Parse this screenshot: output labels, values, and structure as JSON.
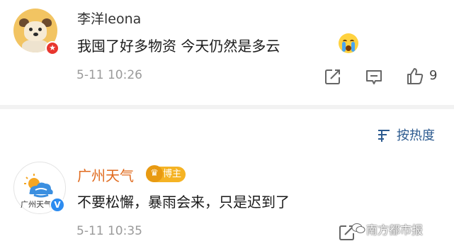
{
  "comments": [
    {
      "username": "李洋leona",
      "avatar": "dog-avatar",
      "avatar_badge": "★",
      "text": "我囤了好多物资 今天仍然是多云",
      "emoji": "crying-face-emoji",
      "time": "5-11 10:26",
      "like_count": "9"
    },
    {
      "username": "广州天气",
      "avatar_label": "广州天气",
      "verified_badge": "V",
      "role_badge": "博主",
      "text": "不要松懈，暴雨会来，只是迟到了",
      "time": "5-11 10:35",
      "like_count": ""
    }
  ],
  "sort": {
    "label": "按热度",
    "icon": "sort-icon"
  },
  "watermark": {
    "text": "南方都市报"
  },
  "colors": {
    "username": "#333333",
    "official_name": "#e06b1f",
    "link": "#2c5a8f",
    "meta": "#9a9a9a",
    "divider": "#f2f2f2",
    "verified": "#2d8cf0",
    "badge_red": "#e8362e",
    "role_badge": "#f5b324"
  }
}
